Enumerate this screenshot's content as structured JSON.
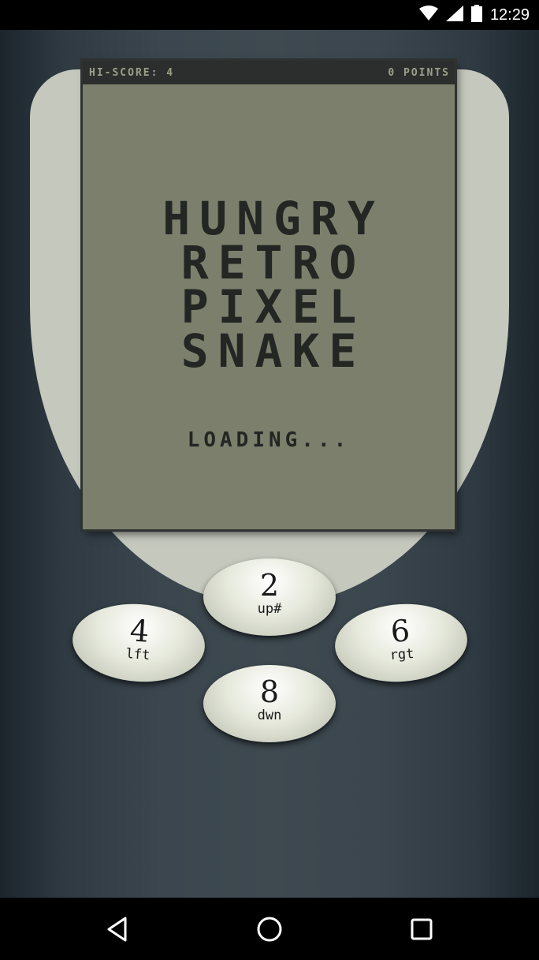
{
  "status_bar": {
    "time": "12:29",
    "icons": [
      "wifi-icon",
      "signal-icon",
      "battery-icon"
    ]
  },
  "screen": {
    "hiscore": "HI-SCORE: 4",
    "points": "0 POINTS",
    "title_lines": [
      "HUNGRY",
      "RETRO",
      "PIXEL",
      "SNAKE"
    ],
    "loading": "LOADING..."
  },
  "keypad": {
    "up": {
      "number": "2",
      "label": "up#"
    },
    "left": {
      "number": "4",
      "label": "lft"
    },
    "right": {
      "number": "6",
      "label": "rgt"
    },
    "down": {
      "number": "8",
      "label": "dwn"
    }
  },
  "nav_bar": {
    "icons": [
      "back-icon",
      "home-icon",
      "recents-icon"
    ]
  },
  "colors": {
    "screen_bg": "#7b7f6c",
    "screen_text": "#232622",
    "phone_face": "#c4c8bd",
    "phone_body": "#3b464e"
  }
}
